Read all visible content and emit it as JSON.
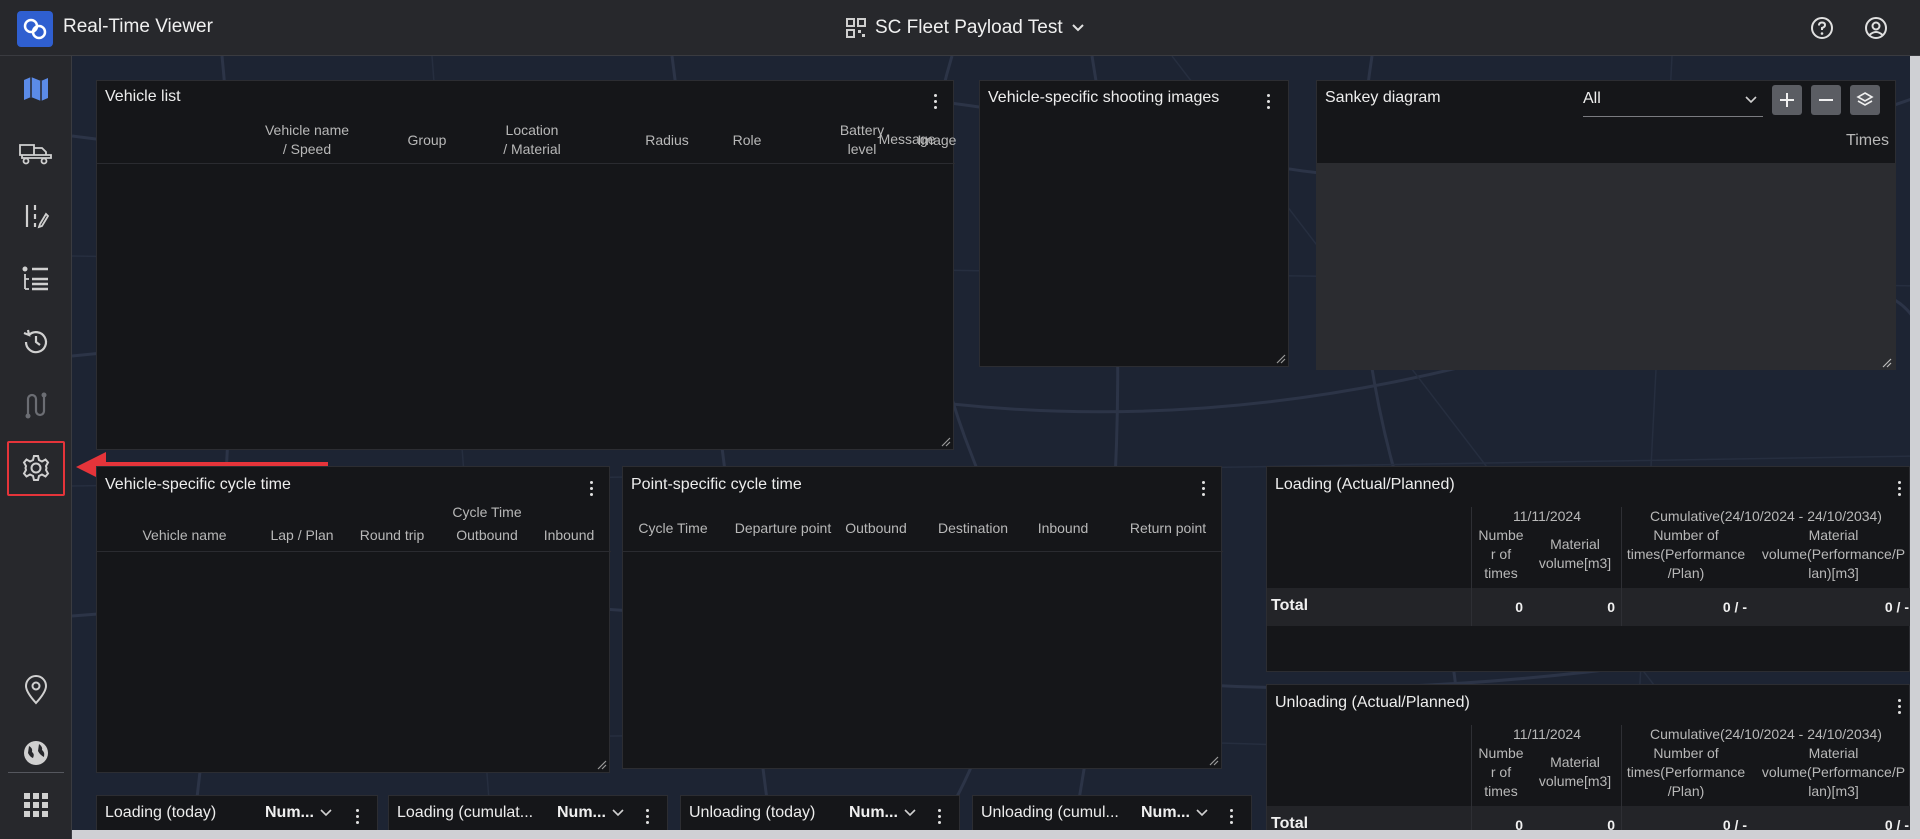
{
  "app": {
    "title": "Real-Time Viewer"
  },
  "project": {
    "name": "SC Fleet Payload Test"
  },
  "colors": {
    "accent": "#2f5fd0",
    "highlight": "#e5343a",
    "map": "#1d2433"
  },
  "sidebar": {
    "items": [
      {
        "icon": "map-icon"
      },
      {
        "icon": "truck-icon"
      },
      {
        "icon": "route-edit-icon"
      },
      {
        "icon": "list-icon"
      },
      {
        "icon": "history-icon"
      },
      {
        "icon": "path-icon"
      },
      {
        "icon": "gear-icon"
      },
      {
        "icon": "location-pin-icon"
      },
      {
        "icon": "globe-icon"
      },
      {
        "icon": "apps-grid-icon"
      }
    ]
  },
  "vehicle_list": {
    "title": "Vehicle list",
    "columns": [
      "Vehicle name / Speed",
      "Group",
      "Location / Material",
      "Radius",
      "Role",
      "Battery level",
      "Image",
      "Message"
    ],
    "col_lines": [
      [
        "Vehicle name",
        "/ Speed"
      ],
      [
        "Group"
      ],
      [
        "Location",
        "/ Material"
      ],
      [
        "Radius"
      ],
      [
        "Role"
      ],
      [
        "Battery",
        "level"
      ],
      [
        "Image"
      ],
      [
        "Message"
      ]
    ]
  },
  "shooting_images": {
    "title": "Vehicle-specific shooting images"
  },
  "sankey": {
    "title": "Sankey diagram",
    "filter_value": "All",
    "unit_label": "Times"
  },
  "cycle_time_vehicle": {
    "title": "Vehicle-specific cycle time",
    "header_top": "Cycle Time",
    "columns": [
      "Vehicle name",
      "Lap / Plan",
      "Round trip",
      "Outbound",
      "Inbound"
    ]
  },
  "cycle_time_point": {
    "title": "Point-specific cycle time",
    "columns": [
      "Cycle Time",
      "Departure point",
      "Outbound",
      "Destination",
      "Inbound",
      "Return point"
    ]
  },
  "loading": {
    "title": "Loading (Actual/Planned)",
    "date_header": "11/11/2024",
    "cumulative_header": "Cumulative(24/10/2024 - 24/10/2034)",
    "sub_headers": [
      [
        "Numbe",
        "r of",
        "times"
      ],
      [
        "Material",
        "volume[m3]"
      ],
      [
        "Number of",
        "times(Performance",
        "/Plan)"
      ],
      [
        "Material",
        "volume(Performance/P",
        "lan)[m3]"
      ]
    ],
    "total_label": "Total",
    "totals": [
      "0",
      "0",
      "0 / -",
      "0 / -"
    ]
  },
  "unloading": {
    "title": "Unloading (Actual/Planned)",
    "date_header": "11/11/2024",
    "cumulative_header": "Cumulative(24/10/2024 - 24/10/2034)",
    "sub_headers": [
      [
        "Numbe",
        "r of",
        "times"
      ],
      [
        "Material",
        "volume[m3]"
      ],
      [
        "Number of",
        "times(Performance",
        "/Plan)"
      ],
      [
        "Material",
        "volume(Performance/P",
        "lan)[m3]"
      ]
    ],
    "total_label": "Total",
    "totals": [
      "0",
      "0",
      "0 / -",
      "0 / -"
    ]
  },
  "bottom_widgets": [
    {
      "title": "Loading (today)",
      "select": "Num..."
    },
    {
      "title": "Loading (cumulat...",
      "select": "Num..."
    },
    {
      "title": "Unloading (today)",
      "select": "Num..."
    },
    {
      "title": "Unloading (cumul...",
      "select": "Num..."
    }
  ]
}
